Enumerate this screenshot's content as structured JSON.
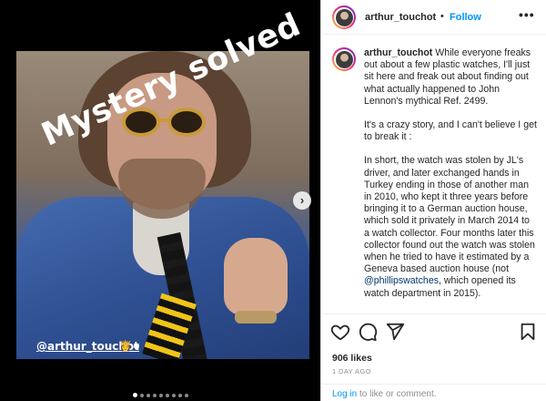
{
  "media": {
    "overlay_text": "Mystery solved",
    "mention": "@arthur_touchot",
    "mention_emoji": "👸",
    "carousel": {
      "count": 9,
      "active_index": 0
    }
  },
  "header": {
    "username": "arthur_touchot",
    "separator": "•",
    "follow_label": "Follow",
    "more_label": "•••"
  },
  "caption": {
    "username": "arthur_touchot",
    "p1": "While everyone freaks out about a few plastic watches, I'll just sit here and freak out about finding out what actually happened to John Lennon's mythical Ref. 2499.",
    "p2": "It's a crazy story, and I can't believe I get to break it :",
    "p3": "In short, the watch was stolen by JL's driver, and later exchanged hands in Turkey ending in those of another man in 2010, who kept it three years before bringing it to a German auction house, which sold it privately in March 2014 to a watch collector. Four months later this collector found out the watch was stolen when he tried to have it estimated by a Geneva based auction house (not",
    "mention": "@phillipswatches",
    "p3_tail": ", which opened its watch department in 2015)."
  },
  "actions": {
    "likes": "906 likes",
    "time": "1 DAY AGO",
    "login_link": "Log in",
    "login_rest": " to like or comment."
  },
  "icons": [
    "heart-icon",
    "comment-icon",
    "share-icon",
    "bookmark-icon",
    "chevron-right-icon",
    "more-icon"
  ]
}
